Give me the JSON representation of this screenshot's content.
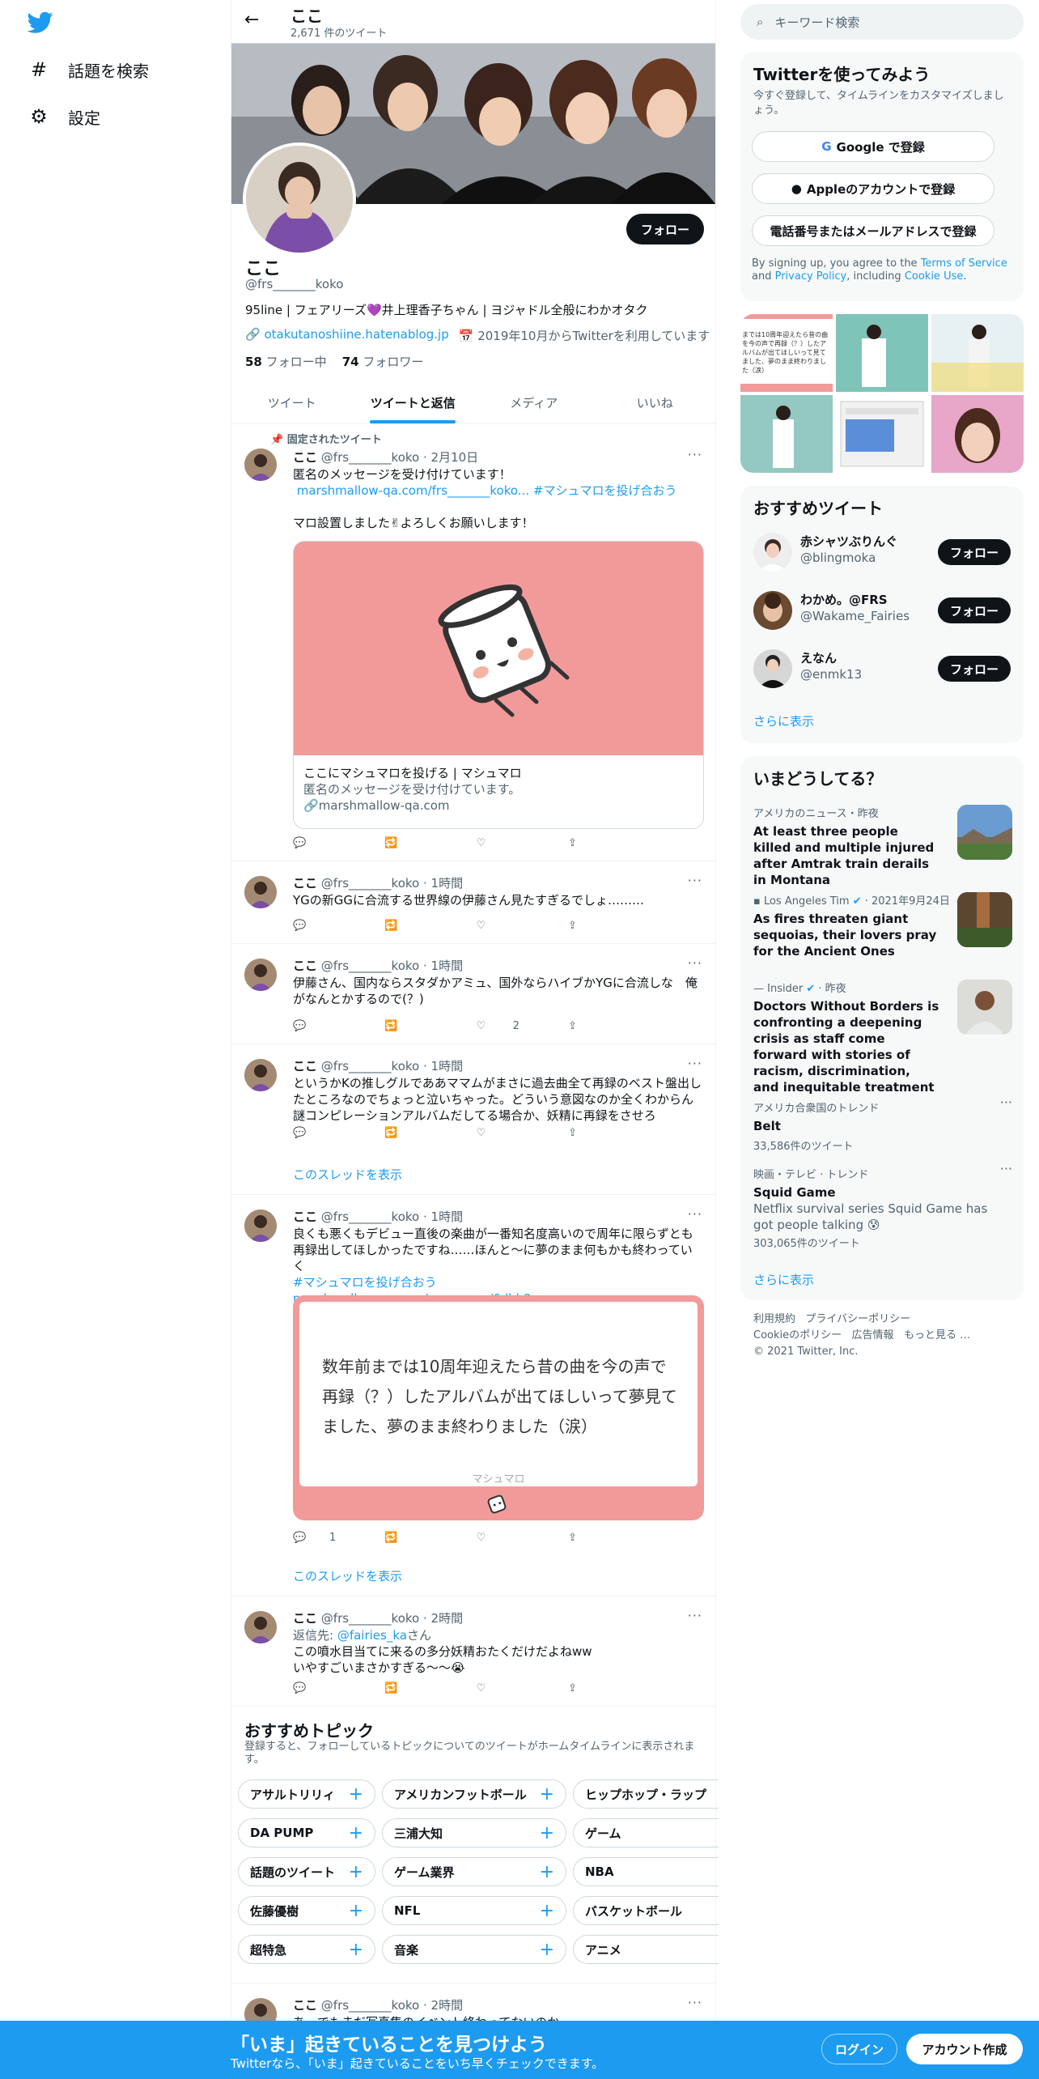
{
  "nav": {
    "explore": "話題を検索",
    "settings": "設定"
  },
  "header": {
    "name": "ここ",
    "count": "2,671 件のツイート"
  },
  "profile": {
    "follow": "フォロー",
    "name": "ここ",
    "handle": "@frs_______koko",
    "bio": "95line | フェアリーズ💜井上理香子ちゃん | ヨジャドル全般にわかオタク",
    "link": "otakutanoshiine.hatenablog.jp",
    "joined": "2019年10月からTwitterを利用しています",
    "following_count": "58",
    "following_label": "フォロー中",
    "followers_count": "74",
    "followers_label": "フォロワー"
  },
  "tabs": [
    "ツイート",
    "ツイートと返信",
    "メディア",
    "いいね"
  ],
  "pinned_label": "固定されたツイート",
  "tweets": [
    {
      "name": "ここ",
      "meta": "@frs_______koko · 2月10日",
      "text1": "匿名のメッセージを受け付けています！",
      "link1": "marshmallow-qa.com/frs_______koko...",
      "tag1": "#マシュマロを投げ合おう",
      "text2": "マロ設置しました✌よろしくお願いします！",
      "card_title": "ここにマシュマロを投げる | マシュマロ",
      "card_desc": "匿名のメッセージを受け付けています。",
      "card_domain": "marshmallow-qa.com"
    },
    {
      "name": "ここ",
      "meta": "@frs_______koko · 1時間",
      "text": "YGの新GGに合流する世界線の伊藤さん見たすぎるでしょ………"
    },
    {
      "name": "ここ",
      "meta": "@frs_______koko · 1時間",
      "text": "伊藤さん、国内ならスタダかアミュ、国外ならハイブかYGに合流しな　俺がなんとかするので(？)",
      "likes": "2"
    },
    {
      "name": "ここ",
      "meta": "@frs_______koko · 1時間",
      "text": "というかKの推しグルでああママムがまさに過去曲全て再録のベスト盤出したところなのでちょっと泣いちゃった。どういう意図なのか全くわからん謎コンピレーションアルバムだしてる場合か、妖精に再録をさせろ",
      "thread": "このスレッドを表示"
    },
    {
      "name": "ここ",
      "meta": "@frs_______koko · 1時間",
      "text": "良くも悪くもデビュー直後の楽曲が一番知名度高いので周年に限らずとも再録出してほしかったですね……ほんと〜に夢のまま何もかも終わっていく",
      "tag": "#マシュマロを投げ合おう",
      "link": "marshmallow-qa.com/messages/6dbb2...",
      "card_text": "数年前までは10周年迎えたら昔の曲を今の声で再録（？）したアルバムが出てほしいって夢見てました、夢のまま終わりました（涙）",
      "card_footer": "マシュマロ",
      "replies": "1",
      "thread": "このスレッドを表示"
    },
    {
      "name": "ここ",
      "meta": "@frs_______koko · 2時間",
      "reply_prefix": "返信先: ",
      "reply_to": "@fairies_ka",
      "reply_suffix": "さん",
      "text1": "この噴水目当てに来るの多分妖精おたくだけだよねww",
      "text2": "いやすごいまさかすぎる〜〜😭"
    },
    {
      "name": "ここ",
      "meta": "@frs_______koko · 2時間",
      "text": "あ、でもまだ写真集のイベント終わってないのか"
    }
  ],
  "topics": {
    "title": "おすすめトピック",
    "desc": "登録すると、フォローしているトピックについてのツイートがホームタイムラインに表示されます。",
    "items": [
      "アサルトリリィ",
      "アメリカンフットボール",
      "ヒップホップ・ラップ",
      "DA PUMP",
      "三浦大知",
      "ゲーム",
      "話題のツイート",
      "ゲーム業界",
      "NBA",
      "佐藤優樹",
      "NFL",
      "バスケットボール",
      "超特急",
      "音楽",
      "アニメ"
    ]
  },
  "search": {
    "placeholder": "キーワード検索"
  },
  "signup": {
    "title": "Twitterを使ってみよう",
    "desc": "今すぐ登録して、タイムラインをカスタマイズしましょう。",
    "google": "Google で登録",
    "apple": "Appleのアカウントで登録",
    "phone": "電話番号またはメールアドレスで登録",
    "terms_pre": "By signing up, you agree to the ",
    "terms": "Terms of Service",
    "terms_and": " and ",
    "privacy": "Privacy Policy",
    "terms_incl": ", including ",
    "cookie": "Cookie Use",
    "terms_end": "."
  },
  "media_grid": {
    "quote": "までは10周年迎えたら昔の曲を今の声で再録（？）したアルバムが出てほしいって見てました、夢のまま終わりました（涙）"
  },
  "who_to_follow": {
    "title": "おすすめツイート",
    "users": [
      {
        "name": "赤シャツぶりんぐ",
        "handle": "@blingmoka",
        "button": "フォロー"
      },
      {
        "name": "わかめ。@FRS",
        "handle": "@Wakame_Fairies",
        "button": "フォロー"
      },
      {
        "name": "えなん",
        "handle": "@enmk13",
        "button": "フォロー"
      }
    ],
    "more": "さらに表示"
  },
  "trends": {
    "title": "いまどうしてる？",
    "items": [
      {
        "meta": "アメリカのニュース・昨夜",
        "title": "At least three people killed and multiple injured after Amtrak train derails in Montana"
      },
      {
        "meta": "Los Angeles Tim",
        "meta2": "· 2021年9月24日",
        "title": "As fires threaten giant sequoias, their lovers pray for the Ancient Ones"
      },
      {
        "meta": "Insider",
        "meta2": "· 昨夜",
        "title": "Doctors Without Borders is confronting a deepening crisis as staff come forward with stories of racism, discrimination, and inequitable treatment"
      },
      {
        "meta": "アメリカ合衆国のトレンド",
        "title": "Belt",
        "sub": "33,586件のツイート"
      },
      {
        "meta": "映画・テレビ · トレンド",
        "title": "Squid Game",
        "sub": "Netflix survival series Squid Game has got people talking 😰",
        "sub2": "303,065件のツイート"
      }
    ],
    "more": "さらに表示"
  },
  "footer": {
    "terms": "利用規約",
    "privacy": "プライバシーポリシー",
    "cookie": "Cookieのポリシー",
    "ads": "広告情報",
    "more": "もっと見る …",
    "copy": "© 2021 Twitter, Inc."
  },
  "bottom": {
    "headline": "「いま」起きていることを見つけよう",
    "sub": "Twitterなら、「いま」起きていることをいち早くチェックできます。",
    "login": "ログイン",
    "signup": "アカウント作成"
  }
}
